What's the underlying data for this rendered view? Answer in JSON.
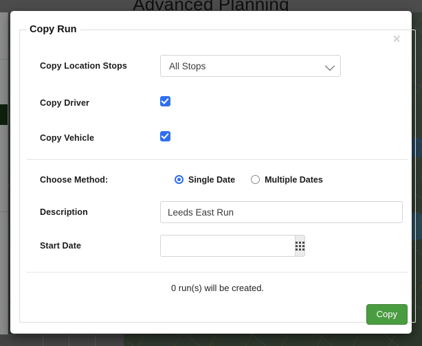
{
  "background": {
    "page_title": "Advanced Planning"
  },
  "modal": {
    "legend": "Copy Run",
    "close_label": "×",
    "close_icon": "close-icon",
    "fields": {
      "copy_location_stops": {
        "label": "Copy Location Stops",
        "selected": "All Stops",
        "options": [
          "All Stops"
        ],
        "caret_icon": "chevron-down-icon"
      },
      "copy_driver": {
        "label": "Copy Driver",
        "checked": true,
        "check_icon": "checkmark-icon"
      },
      "copy_vehicle": {
        "label": "Copy Vehicle",
        "checked": true,
        "check_icon": "checkmark-icon"
      },
      "choose_method": {
        "label": "Choose Method:",
        "options": [
          {
            "label": "Single Date",
            "selected": true
          },
          {
            "label": "Multiple Dates",
            "selected": false
          }
        ]
      },
      "description": {
        "label": "Description",
        "value": "Leeds East Run",
        "placeholder": ""
      },
      "start_date": {
        "label": "Start Date",
        "value": "",
        "placeholder": "",
        "calendar_icon": "calendar-grid-icon"
      }
    },
    "footer": {
      "note": "0 run(s) will be created.",
      "copy_label": "Copy"
    }
  },
  "colors": {
    "accent_blue": "#2e6ef4",
    "primary_green": "#4a9c41",
    "border_gray": "#d4d4d4",
    "overlay": "rgba(0,0,0,0.45)"
  }
}
